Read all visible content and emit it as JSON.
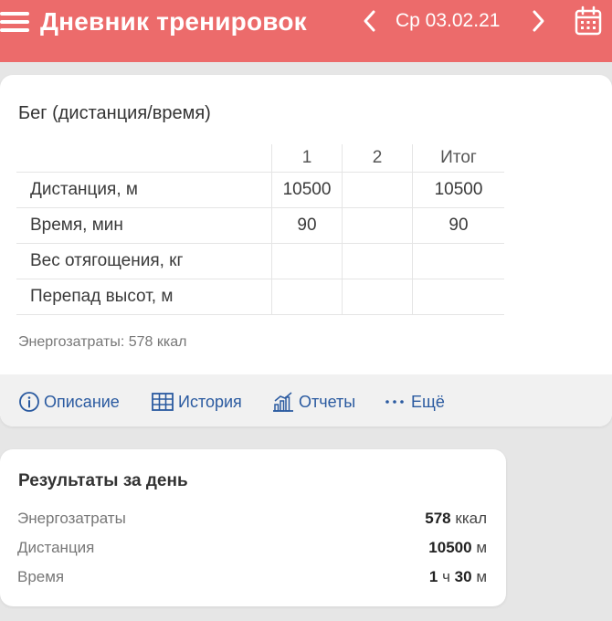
{
  "header": {
    "title": "Дневник тренировок",
    "date": "Ср 03.02.21",
    "background_color": "#ec6b6b",
    "icons": [
      "menu-icon",
      "chevron-left-icon",
      "chevron-right-icon",
      "calendar-icon"
    ]
  },
  "exercise": {
    "title": "Бег (дистанция/время)",
    "table": {
      "columns": [
        "1",
        "2",
        "Итог"
      ],
      "rows": [
        {
          "label": "Дистанция, м",
          "values": [
            "10500",
            "",
            "10500"
          ]
        },
        {
          "label": "Время, мин",
          "values": [
            "90",
            "",
            "90"
          ]
        },
        {
          "label": "Вес отягощения, кг",
          "values": [
            "",
            "",
            ""
          ]
        },
        {
          "label": "Перепад высот, м",
          "values": [
            "",
            "",
            ""
          ]
        }
      ]
    },
    "energy": "Энергозатраты: 578 ккал",
    "actions": {
      "description": "Описание",
      "history": "История",
      "reports": "Отчеты",
      "more": "Ещё"
    },
    "action_color": "#2a5aa0"
  },
  "results": {
    "title": "Результаты за день",
    "rows": [
      {
        "label": "Энергозатраты",
        "value": "578",
        "unit": "ккал"
      },
      {
        "label": "Дистанция",
        "value": "10500",
        "unit": "м"
      },
      {
        "label": "Время",
        "hours": "1",
        "hours_unit": "ч",
        "minutes": "30",
        "minutes_unit": "м"
      }
    ]
  }
}
